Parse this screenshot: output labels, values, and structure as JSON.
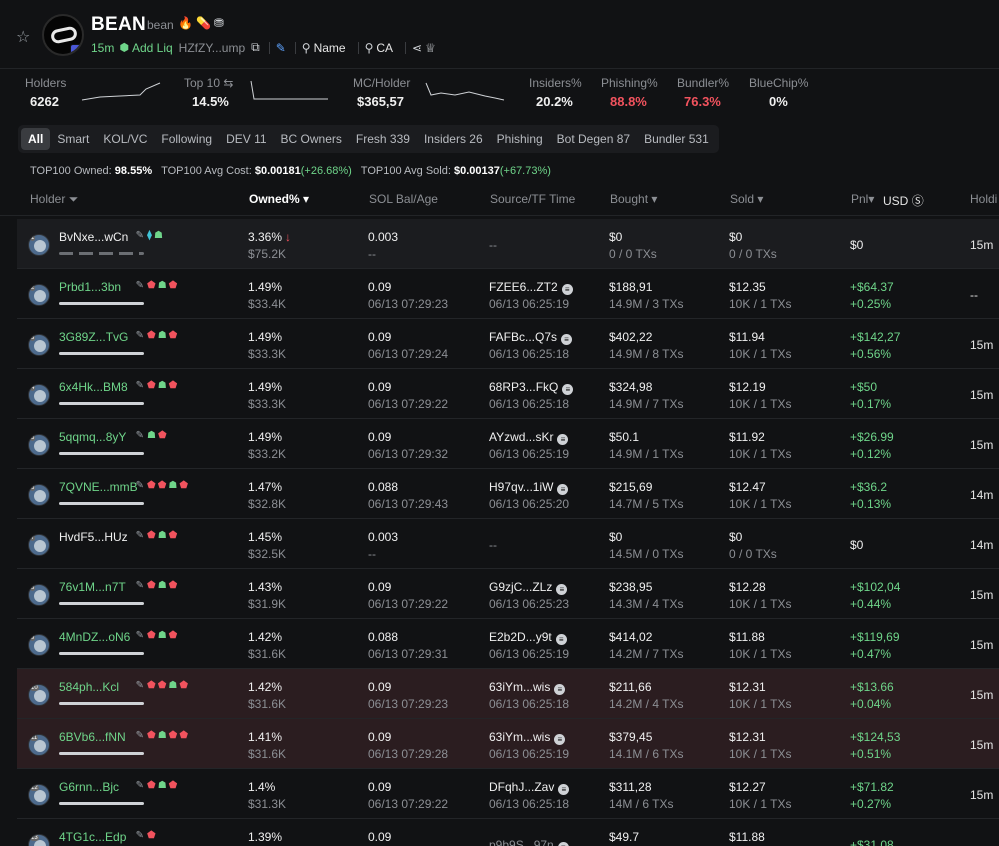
{
  "header": {
    "symbol": "BEAN",
    "name": "bean",
    "age": "15m",
    "add_liq": "Add Liq",
    "ca_short": "HZfZY...ump",
    "name_search": "Name",
    "ca_search": "CA"
  },
  "stats": [
    {
      "label": "Holders",
      "value": "6262",
      "color": "white"
    },
    {
      "label": "Top 10",
      "value": "14.5%",
      "color": "white"
    },
    {
      "label": "MC/Holder",
      "value": "$365,57",
      "color": "white"
    },
    {
      "label": "Insiders%",
      "value": "20.2%",
      "color": "white"
    },
    {
      "label": "Phishing%",
      "value": "88.8%",
      "color": "red"
    },
    {
      "label": "Bundler%",
      "value": "76.3%",
      "color": "red"
    },
    {
      "label": "BlueChip%",
      "value": "0%",
      "color": "white"
    }
  ],
  "tabs": [
    "All",
    "Smart",
    "KOL/VC",
    "Following",
    "DEV 11",
    "BC Owners",
    "Fresh 339",
    "Insiders 26",
    "Phishing",
    "Bot Degen 87",
    "Bundler 531"
  ],
  "summary": {
    "owned_label": "TOP100 Owned:",
    "owned_value": "98.55%",
    "cost_label": "TOP100 Avg Cost:",
    "cost_value": "$0.00181",
    "cost_change": "(+26.68%)",
    "sold_label": "TOP100 Avg Sold:",
    "sold_value": "$0.00137",
    "sold_change": "(+67.73%)"
  },
  "columns": {
    "holder": "Holder",
    "owned": "Owned%",
    "sol": "SOL Bal/Age",
    "source": "Source/TF Time",
    "bought": "Bought",
    "sold": "Sold",
    "pnl": "Pnl",
    "usd": "USD",
    "holding": "Holdi"
  },
  "rows": [
    {
      "rank": "1",
      "addr": "BvNxe...wCn",
      "addr_color": "white",
      "tags": [
        "cyan",
        "green"
      ],
      "owned": "3.36%",
      "owned_usd": "$75.2K",
      "down": true,
      "sol": "0.003",
      "sol_age": "--",
      "src": "--",
      "src_time": "",
      "bought": "$0",
      "bought_sub": "0 / 0 TXs",
      "sold": "$0",
      "sold_sub": "0 / 0 TXs",
      "pnl": "$0",
      "pnl_pct": "",
      "pnl_color": "white",
      "hold": "15m",
      "style": "dark",
      "bar": "dashed"
    },
    {
      "rank": "2",
      "addr": "Prbd1...3bn",
      "addr_color": "green",
      "tags": [
        "red",
        "green",
        "red"
      ],
      "owned": "1.49%",
      "owned_usd": "$33.4K",
      "down": false,
      "sol": "0.09",
      "sol_age": "06/13 07:29:23",
      "src": "FZEE6...ZT2",
      "src_time": "06/13 06:25:19",
      "bought": "$188,91",
      "bought_sub": "14.9M / 3 TXs",
      "sold": "$12.35",
      "sold_sub": "10K / 1 TXs",
      "pnl": "+$64.37",
      "pnl_pct": "+0.25%",
      "pnl_color": "green",
      "hold": "--",
      "style": "",
      "bar": "solid"
    },
    {
      "rank": "3",
      "addr": "3G89Z...TvG",
      "addr_color": "green",
      "tags": [
        "red",
        "green",
        "red"
      ],
      "owned": "1.49%",
      "owned_usd": "$33.3K",
      "down": false,
      "sol": "0.09",
      "sol_age": "06/13 07:29:24",
      "src": "FAFBc...Q7s",
      "src_time": "06/13 06:25:18",
      "bought": "$402,22",
      "bought_sub": "14.9M / 8 TXs",
      "sold": "$11.94",
      "sold_sub": "10K / 1 TXs",
      "pnl": "+$142,27",
      "pnl_pct": "+0.56%",
      "pnl_color": "green",
      "hold": "15m",
      "style": "",
      "bar": "solid"
    },
    {
      "rank": "4",
      "addr": "6x4Hk...BM8",
      "addr_color": "green",
      "tags": [
        "red",
        "green",
        "red"
      ],
      "owned": "1.49%",
      "owned_usd": "$33.3K",
      "down": false,
      "sol": "0.09",
      "sol_age": "06/13 07:29:22",
      "src": "68RP3...FkQ",
      "src_time": "06/13 06:25:18",
      "bought": "$324,98",
      "bought_sub": "14.9M / 7 TXs",
      "sold": "$12.19",
      "sold_sub": "10K / 1 TXs",
      "pnl": "+$50",
      "pnl_pct": "+0.17%",
      "pnl_color": "green",
      "hold": "15m",
      "style": "",
      "bar": "solid"
    },
    {
      "rank": "5",
      "addr": "5qqmq...8yY",
      "addr_color": "green",
      "tags": [
        "green",
        "red"
      ],
      "owned": "1.49%",
      "owned_usd": "$33.2K",
      "down": false,
      "sol": "0.09",
      "sol_age": "06/13 07:29:32",
      "src": "AYzwd...sKr",
      "src_time": "06/13 06:25:19",
      "bought": "$50.1",
      "bought_sub": "14.9M / 1 TXs",
      "sold": "$11.92",
      "sold_sub": "10K / 1 TXs",
      "pnl": "+$26.99",
      "pnl_pct": "+0.12%",
      "pnl_color": "green",
      "hold": "15m",
      "style": "",
      "bar": "solid"
    },
    {
      "rank": "6",
      "addr": "7QVNE...mmB",
      "addr_color": "green",
      "tags": [
        "red",
        "red",
        "green",
        "red"
      ],
      "owned": "1.47%",
      "owned_usd": "$32.8K",
      "down": false,
      "sol": "0.088",
      "sol_age": "06/13 07:29:43",
      "src": "H97qv...1iW",
      "src_time": "06/13 06:25:20",
      "bought": "$215,69",
      "bought_sub": "14.7M / 5 TXs",
      "sold": "$12.47",
      "sold_sub": "10K / 1 TXs",
      "pnl": "+$36.2",
      "pnl_pct": "+0.13%",
      "pnl_color": "green",
      "hold": "14m",
      "style": "",
      "bar": "solid"
    },
    {
      "rank": "7",
      "addr": "HvdF5...HUz",
      "addr_color": "white",
      "tags": [
        "red",
        "green",
        "red"
      ],
      "owned": "1.45%",
      "owned_usd": "$32.5K",
      "down": false,
      "sol": "0.003",
      "sol_age": "--",
      "src": "--",
      "src_time": "",
      "bought": "$0",
      "bought_sub": "14.5M / 0 TXs",
      "sold": "$0",
      "sold_sub": "0 / 0 TXs",
      "pnl": "$0",
      "pnl_pct": "",
      "pnl_color": "white",
      "hold": "14m",
      "style": "",
      "bar": "none"
    },
    {
      "rank": "8",
      "addr": "76v1M...n7T",
      "addr_color": "green",
      "tags": [
        "red",
        "green",
        "red"
      ],
      "owned": "1.43%",
      "owned_usd": "$31.9K",
      "down": false,
      "sol": "0.09",
      "sol_age": "06/13 07:29:22",
      "src": "G9zjC...ZLz",
      "src_time": "06/13 06:25:23",
      "bought": "$238,95",
      "bought_sub": "14.3M / 4 TXs",
      "sold": "$12.28",
      "sold_sub": "10K / 1 TXs",
      "pnl": "+$102,04",
      "pnl_pct": "+0.44%",
      "pnl_color": "green",
      "hold": "15m",
      "style": "",
      "bar": "solid"
    },
    {
      "rank": "9",
      "addr": "4MnDZ...oN6",
      "addr_color": "green",
      "tags": [
        "red",
        "green",
        "red"
      ],
      "owned": "1.42%",
      "owned_usd": "$31.6K",
      "down": false,
      "sol": "0.088",
      "sol_age": "06/13 07:29:31",
      "src": "E2b2D...y9t",
      "src_time": "06/13 06:25:19",
      "bought": "$414,02",
      "bought_sub": "14.2M / 7 TXs",
      "sold": "$11.88",
      "sold_sub": "10K / 1 TXs",
      "pnl": "+$119,69",
      "pnl_pct": "+0.47%",
      "pnl_color": "green",
      "hold": "15m",
      "style": "",
      "bar": "solid"
    },
    {
      "rank": "10",
      "addr": "584ph...Kcl",
      "addr_color": "green",
      "tags": [
        "red",
        "red",
        "green",
        "red"
      ],
      "owned": "1.42%",
      "owned_usd": "$31.6K",
      "down": false,
      "sol": "0.09",
      "sol_age": "06/13 07:29:23",
      "src": "63iYm...wis",
      "src_time": "06/13 06:25:18",
      "bought": "$211,66",
      "bought_sub": "14.2M / 4 TXs",
      "sold": "$12.31",
      "sold_sub": "10K / 1 TXs",
      "pnl": "+$13.66",
      "pnl_pct": "+0.04%",
      "pnl_color": "green",
      "hold": "15m",
      "style": "red",
      "bar": "solid"
    },
    {
      "rank": "11",
      "addr": "6BVb6...fNN",
      "addr_color": "green",
      "tags": [
        "red",
        "green",
        "red",
        "red"
      ],
      "owned": "1.41%",
      "owned_usd": "$31.6K",
      "down": false,
      "sol": "0.09",
      "sol_age": "06/13 07:29:28",
      "src": "63iYm...wis",
      "src_time": "06/13 06:25:19",
      "bought": "$379,45",
      "bought_sub": "14.1M / 6 TXs",
      "sold": "$12.31",
      "sold_sub": "10K / 1 TXs",
      "pnl": "+$124,53",
      "pnl_pct": "+0.51%",
      "pnl_color": "green",
      "hold": "15m",
      "style": "red",
      "bar": "solid"
    },
    {
      "rank": "12",
      "addr": "G6rnn...Bjc",
      "addr_color": "green",
      "tags": [
        "red",
        "green",
        "red"
      ],
      "owned": "1.4%",
      "owned_usd": "$31.3K",
      "down": false,
      "sol": "0.09",
      "sol_age": "06/13 07:29:22",
      "src": "DFqhJ...Zav",
      "src_time": "06/13 06:25:18",
      "bought": "$311,28",
      "bought_sub": "14M / 6 TXs",
      "sold": "$12.27",
      "sold_sub": "10K / 1 TXs",
      "pnl": "+$71.82",
      "pnl_pct": "+0.27%",
      "pnl_color": "green",
      "hold": "15m",
      "style": "",
      "bar": "solid"
    },
    {
      "rank": "13",
      "addr": "4TG1c...Edp",
      "addr_color": "green",
      "tags": [
        "red"
      ],
      "owned": "1.39%",
      "owned_usd": "",
      "down": false,
      "sol": "0.09",
      "sol_age": "",
      "src": "p9b9S...97n",
      "src_time": "",
      "bought": "$49.7",
      "bought_sub": "",
      "sold": "$11.88",
      "sold_sub": "",
      "pnl": "+$31.08",
      "pnl_pct": "",
      "pnl_color": "green",
      "hold": "",
      "style": "",
      "bar": "solid"
    }
  ]
}
